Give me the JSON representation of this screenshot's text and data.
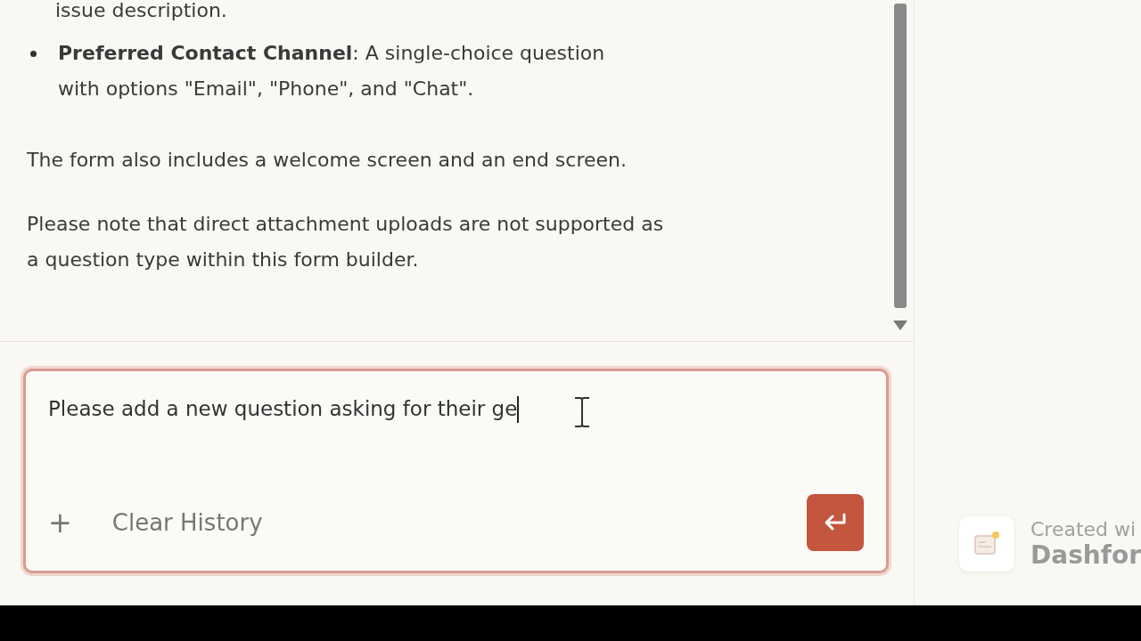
{
  "chat": {
    "messages": [
      {
        "kind": "continuation",
        "text": "issue description."
      },
      {
        "kind": "bullet",
        "text": "**Preferred Contact Channel**: A single-choice question with options \"Email\", \"Phone\", and \"Chat\"."
      },
      {
        "kind": "paragraph",
        "text": "The form also includes a welcome screen and an end screen."
      },
      {
        "kind": "paragraph",
        "text": "Please note that direct attachment uploads are not supported as a question type within this form builder."
      }
    ]
  },
  "composer": {
    "value": "Please add a new question asking for their ge",
    "focused": true,
    "add_label": "+",
    "clear_label": "Clear History"
  },
  "badge": {
    "caption": "Created wi",
    "brand": "Dashfor"
  }
}
